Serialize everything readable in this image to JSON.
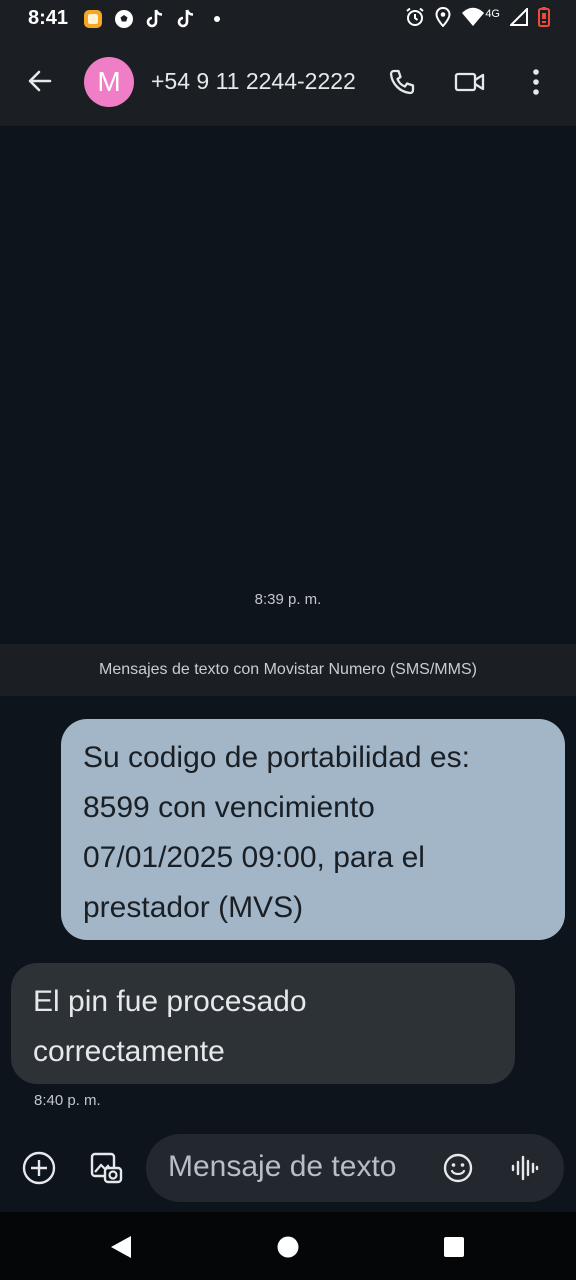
{
  "status_bar": {
    "time": "8:41",
    "network_label": "4G",
    "notification_icons": [
      "app-icon",
      "soccer-icon",
      "tiktok-icon",
      "tiktok-icon",
      "dot-icon"
    ],
    "system_icons": [
      "alarm-icon",
      "location-icon",
      "wifi-icon",
      "signal-icon",
      "battery-low-icon"
    ]
  },
  "app_bar": {
    "avatar_letter": "M",
    "avatar_color": "#f07ec7",
    "contact": "+54 9 11 2244-2222"
  },
  "conversation": {
    "timestamp_top": "8:39 p. m.",
    "banner": "Mensajes de texto con Movistar Numero (SMS/MMS)",
    "messages": [
      {
        "direction": "outgoing",
        "lines": [
          "Su codigo de portabilidad es:",
          "8599 con vencimiento",
          "07/01/2025 09:00, para el",
          "prestador (MVS)"
        ],
        "color": "#a3b6c7"
      },
      {
        "direction": "incoming",
        "lines": [
          "El pin fue procesado",
          "correctamente"
        ],
        "color": "#2d3237"
      }
    ],
    "timestamp_bottom": "8:40 p. m."
  },
  "compose": {
    "placeholder": "Mensaje de texto"
  }
}
